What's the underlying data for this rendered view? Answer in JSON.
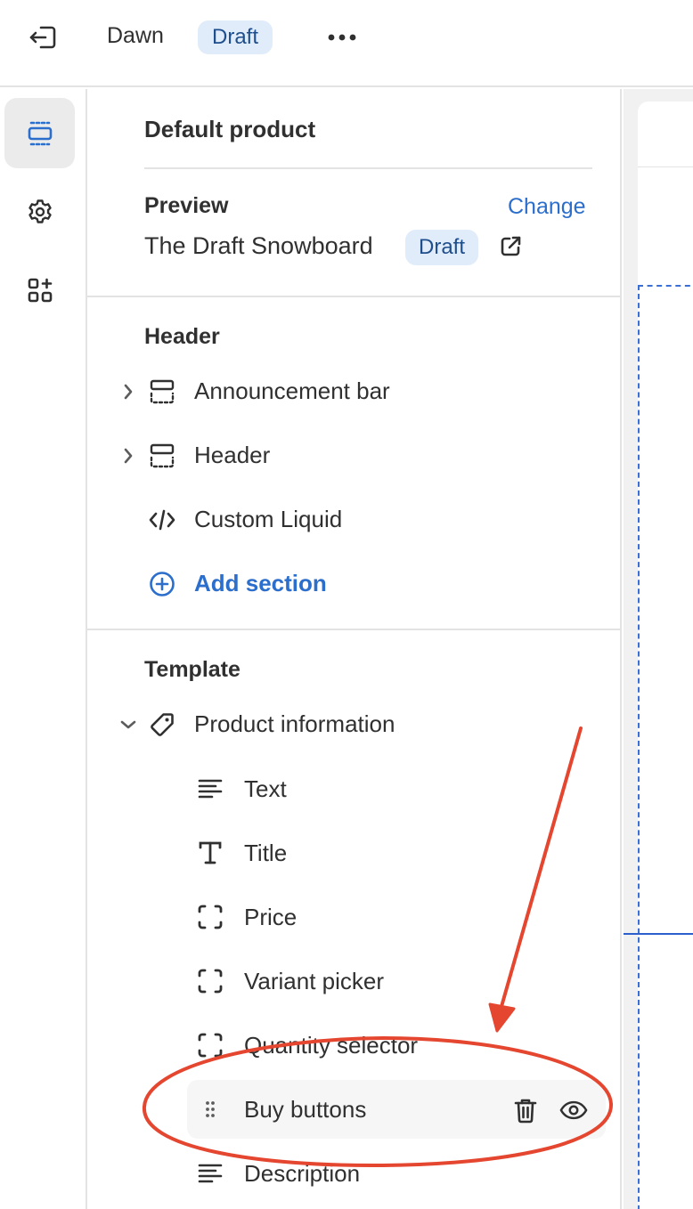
{
  "topbar": {
    "theme_name": "Dawn",
    "status_badge": "Draft",
    "icons": {
      "exit": "exit-icon",
      "more": "more-horizontal-icon"
    }
  },
  "rail": {
    "items": [
      {
        "id": "sections",
        "icon": "layout-sections-icon",
        "active": true
      },
      {
        "id": "settings",
        "icon": "gear-icon",
        "active": false
      },
      {
        "id": "apps",
        "icon": "apps-add-icon",
        "active": false
      }
    ]
  },
  "panel": {
    "title": "Default product",
    "preview": {
      "label": "Preview",
      "change_link": "Change",
      "product_name": "The Draft Snowboard",
      "product_badge": "Draft"
    },
    "header_group": {
      "title": "Header",
      "items": [
        {
          "label": "Announcement bar",
          "icon": "section-icon",
          "expandable": true
        },
        {
          "label": "Header",
          "icon": "section-icon",
          "expandable": true
        },
        {
          "label": "Custom Liquid",
          "icon": "code-icon",
          "expandable": false
        }
      ],
      "add_section": "Add section"
    },
    "template_group": {
      "title": "Template",
      "section": {
        "label": "Product information",
        "icon": "tag-icon",
        "expanded": true
      },
      "blocks": [
        {
          "label": "Text",
          "icon": "text-lines-icon"
        },
        {
          "label": "Title",
          "icon": "title-t-icon"
        },
        {
          "label": "Price",
          "icon": "block-dashed-icon"
        },
        {
          "label": "Variant picker",
          "icon": "block-dashed-icon"
        },
        {
          "label": "Quantity selector",
          "icon": "block-dashed-icon"
        },
        {
          "label": "Buy buttons",
          "icon": "drag-handle-icon",
          "selected": true
        },
        {
          "label": "Description",
          "icon": "text-lines-icon"
        }
      ]
    }
  },
  "annotation": {
    "color": "#e5462f"
  },
  "colors": {
    "accent": "#2c6ecb",
    "badge_bg": "#e0ecfa",
    "badge_text": "#1f4e8c"
  }
}
